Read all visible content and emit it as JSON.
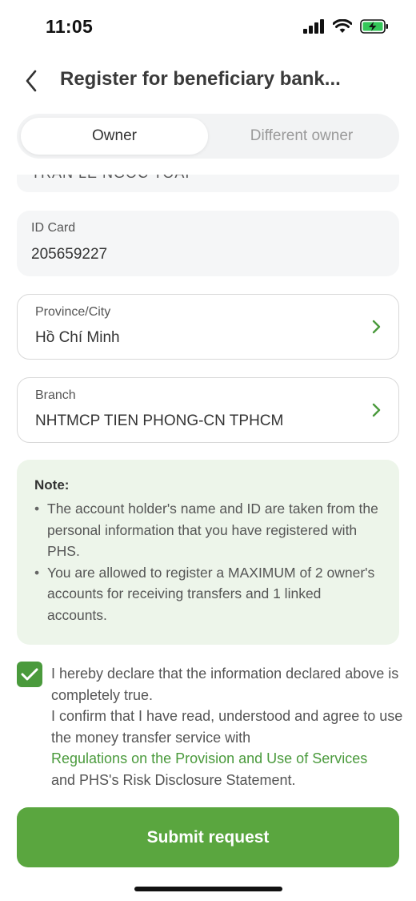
{
  "status_bar": {
    "time": "11:05"
  },
  "header": {
    "title": "Register for beneficiary bank..."
  },
  "tabs": [
    {
      "label": "Owner",
      "active": true
    },
    {
      "label": "Different owner",
      "active": false
    }
  ],
  "cut_field": {
    "value": "TRAN LE NGOC TOAI"
  },
  "id_card": {
    "label": "ID Card",
    "value": "205659227"
  },
  "province": {
    "label": "Province/City",
    "value": "Hồ Chí Minh"
  },
  "branch": {
    "label": "Branch",
    "value": "NHTMCP TIEN PHONG-CN TPHCM"
  },
  "note": {
    "title": "Note:",
    "items": [
      "The account holder's name and ID are taken from the personal information that you have registered with PHS.",
      "You are allowed to register a MAXIMUM of 2 owner's accounts for receiving transfers and 1 linked accounts."
    ]
  },
  "declaration": {
    "checked": true,
    "line1": "I hereby declare that the information declared above is completely true.",
    "line2": "I confirm that I have read, understood and agree to use the money transfer service with",
    "link": "Regulations on the Provision and Use of Services",
    "line3": "and PHS's Risk Disclosure Statement."
  },
  "submit": {
    "label": "Submit request"
  },
  "colors": {
    "accent": "#5aa63f",
    "note_bg": "#edf5ea"
  }
}
